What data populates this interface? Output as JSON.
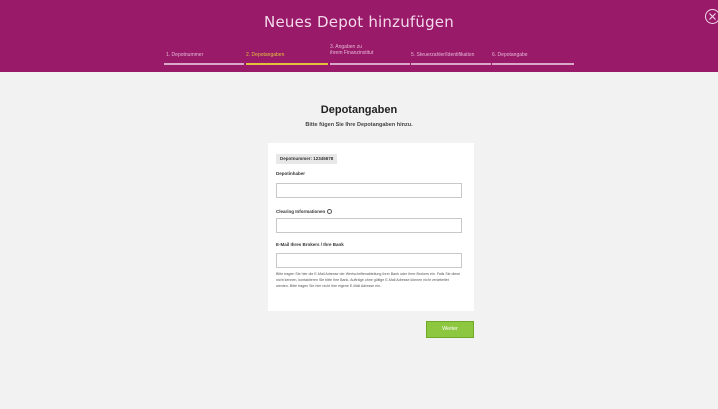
{
  "header": {
    "title": "Neues Depot hinzufügen",
    "steps": [
      {
        "label": "1. Depotnummer",
        "active": false
      },
      {
        "label": "2. Depotangaben",
        "active": true
      },
      {
        "label": "3. Angaben zu ihrem Finanzinstitut",
        "active": false
      },
      {
        "label": "5. Steuerzahler/Identifikation",
        "active": false
      },
      {
        "label": "6. Depotangabe",
        "active": false
      }
    ],
    "accent_color": "#9a1a6a",
    "active_color": "#e2c23a"
  },
  "main": {
    "title": "Depotangaben",
    "subtitle": "Bitte fügen Sie Ihre Depotangaben hinzu.",
    "depot_badge": "Depotnummer: 12345678",
    "fields": [
      {
        "label": "Depotinhaber",
        "value": ""
      },
      {
        "label": "Clearing Informationen",
        "value": ""
      },
      {
        "label": "E-Mail Ihres Brokers / Ihre Bank",
        "value": ""
      }
    ],
    "help_text": "Bitte tragen Sie hier die E-Mail Adresse der Wertschriftenabteilung Ihrer Bank oder Ihrer Brokers ein. Falls Sie diese nicht kennen, kontaktieren Sie bitte Ihre Bank. Aufträge ohne gültige E-Mail Adresse können nicht verarbeitet werden. Bitte tragen Sie hier nicht Ihre eigene E-Mail Adresse ein.",
    "next_button": "Weiter",
    "button_color": "#8dc63f"
  }
}
